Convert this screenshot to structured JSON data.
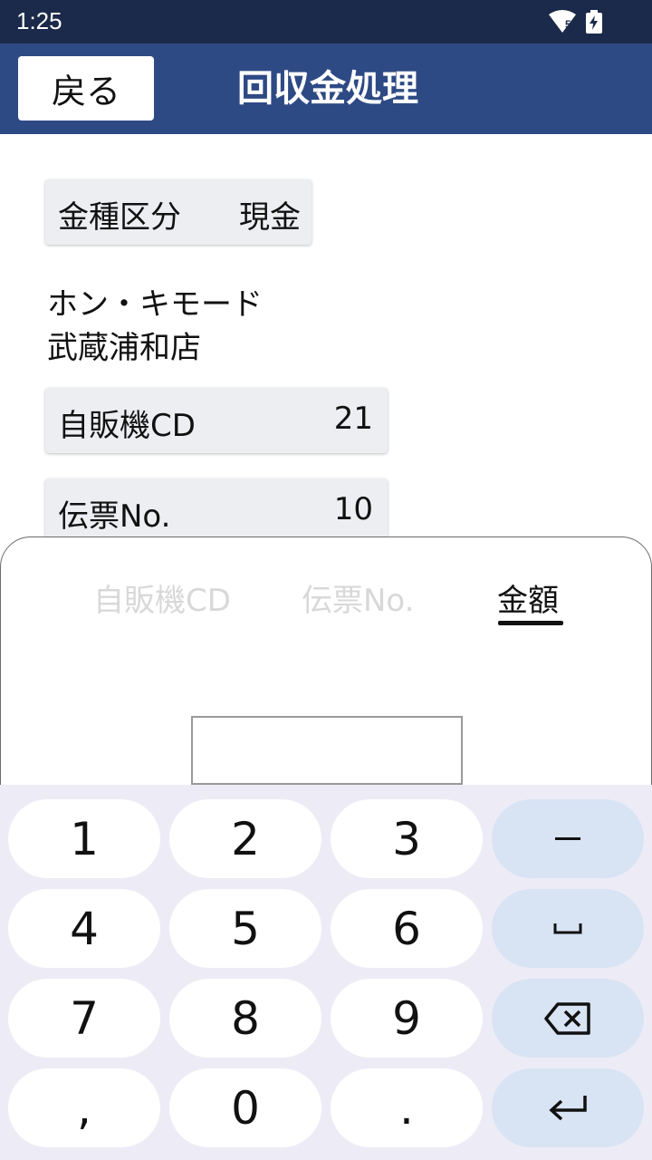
{
  "status_bar": {
    "time": "1:25",
    "wifi_badge": "5"
  },
  "header": {
    "back_label": "戻る",
    "title": "回収金処理"
  },
  "cash_type": {
    "label": "金種区分",
    "value": "現金"
  },
  "store": {
    "line1": "ホン・キモード",
    "line2": "武蔵浦和店"
  },
  "vending_machine": {
    "label": "自販機CD",
    "value": "21"
  },
  "slip": {
    "label": "伝票No.",
    "value": "10"
  },
  "sheet": {
    "tabs": [
      {
        "label": "自販機CD",
        "active": false
      },
      {
        "label": "伝票No.",
        "active": false
      },
      {
        "label": "金額",
        "active": true
      }
    ],
    "amount_value": ""
  },
  "keyboard": {
    "keys": [
      "1",
      "2",
      "3",
      "4",
      "5",
      "6",
      "7",
      "8",
      "9",
      ",",
      "0",
      "."
    ],
    "fn_keys": [
      "minus-icon",
      "space-icon",
      "backspace-icon",
      "enter-icon"
    ]
  },
  "colors": {
    "status_bar": "#1b2a4a",
    "app_bar": "#2e4a85",
    "keyboard_bg": "#edecf6",
    "fn_key": "#d8e3f4"
  }
}
